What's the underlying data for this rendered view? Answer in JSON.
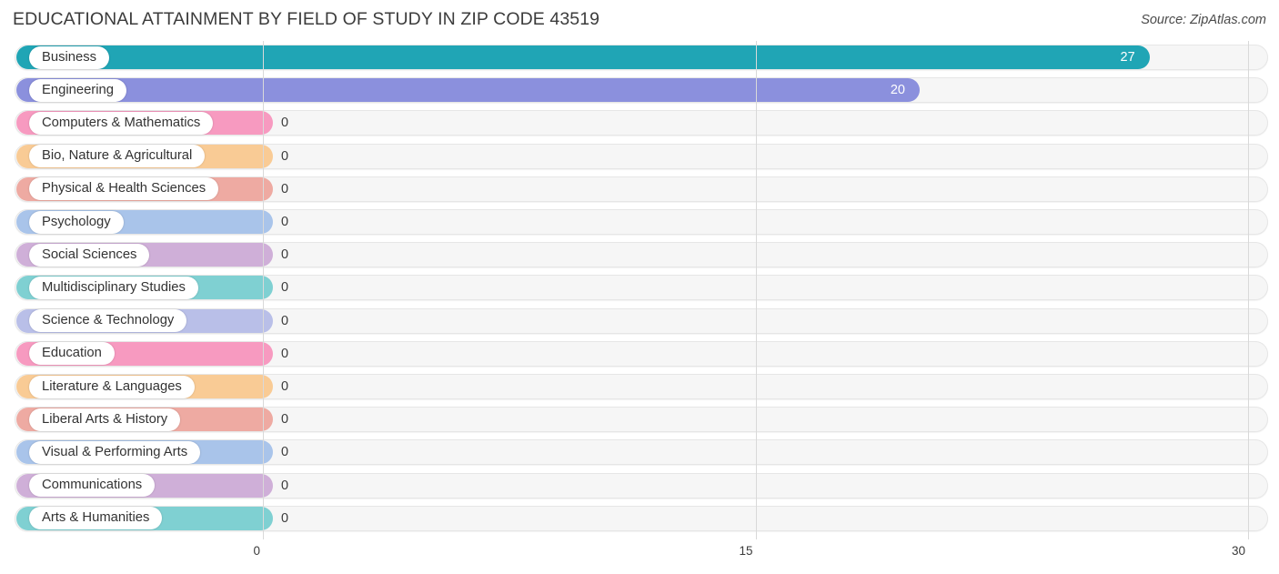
{
  "header": {
    "title": "EDUCATIONAL ATTAINMENT BY FIELD OF STUDY IN ZIP CODE 43519",
    "source": "Source: ZipAtlas.com"
  },
  "chart_data": {
    "type": "bar",
    "orientation": "horizontal",
    "title": "EDUCATIONAL ATTAINMENT BY FIELD OF STUDY IN ZIP CODE 43519",
    "xlabel": "",
    "ylabel": "",
    "xlim": [
      0,
      30
    ],
    "xticks": [
      0,
      15,
      30
    ],
    "xtick_labels": [
      "0",
      "15",
      "30"
    ],
    "grid": true,
    "legend": false,
    "categories": [
      "Business",
      "Engineering",
      "Computers & Mathematics",
      "Bio, Nature & Agricultural",
      "Physical & Health Sciences",
      "Psychology",
      "Social Sciences",
      "Multidisciplinary Studies",
      "Science & Technology",
      "Education",
      "Literature & Languages",
      "Liberal Arts & History",
      "Visual & Performing Arts",
      "Communications",
      "Arts & Humanities"
    ],
    "values": [
      27,
      20,
      0,
      0,
      0,
      0,
      0,
      0,
      0,
      0,
      0,
      0,
      0,
      0,
      0
    ],
    "value_labels": [
      "27",
      "20",
      "0",
      "0",
      "0",
      "0",
      "0",
      "0",
      "0",
      "0",
      "0",
      "0",
      "0",
      "0",
      "0"
    ],
    "colors": [
      "#20a5b5",
      "#8b90dd",
      "#f79ac0",
      "#f9cb95",
      "#eeaaa2",
      "#a9c4ea",
      "#cfafd8",
      "#7fd0d2",
      "#b9bfe8",
      "#f79ac0",
      "#f9cb95",
      "#eeaaa2",
      "#a9c4ea",
      "#cfafd8",
      "#7fd0d2"
    ]
  },
  "colors": {
    "track_fill": "#f6f6f6",
    "track_border": "#e6e6e6",
    "gridline": "#d9d9d9",
    "text": "#3b3b3b",
    "pill_bg": "#ffffff"
  }
}
